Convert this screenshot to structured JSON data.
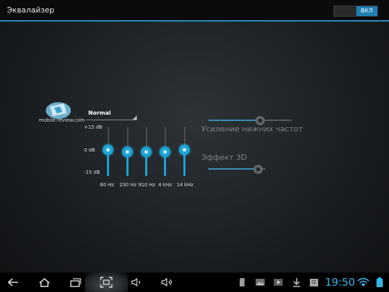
{
  "app": {
    "title": "Эквалайзер",
    "toggle_label": "ВКЛ"
  },
  "watermark": {
    "text": "mobile-review.com"
  },
  "equalizer": {
    "preset": "Normal",
    "db_labels": {
      "top": "+15 dB",
      "mid": "0 dB",
      "bottom": "-15 dB"
    },
    "bands": [
      {
        "freq": "60 Hz",
        "level_db": 1
      },
      {
        "freq": "230 Hz",
        "level_db": 0
      },
      {
        "freq": "910 Hz",
        "level_db": 0
      },
      {
        "freq": "4 kHz",
        "level_db": 0
      },
      {
        "freq": "14 kHz",
        "level_db": 1
      }
    ]
  },
  "effects": {
    "bass_boost": {
      "label": "Усиление нижних частот",
      "level": 0.62
    },
    "virtualizer": {
      "label": "Эффект 3D",
      "level": 0.86
    }
  },
  "system_bar": {
    "clock": "19:50",
    "accent": "#33b5e5"
  }
}
